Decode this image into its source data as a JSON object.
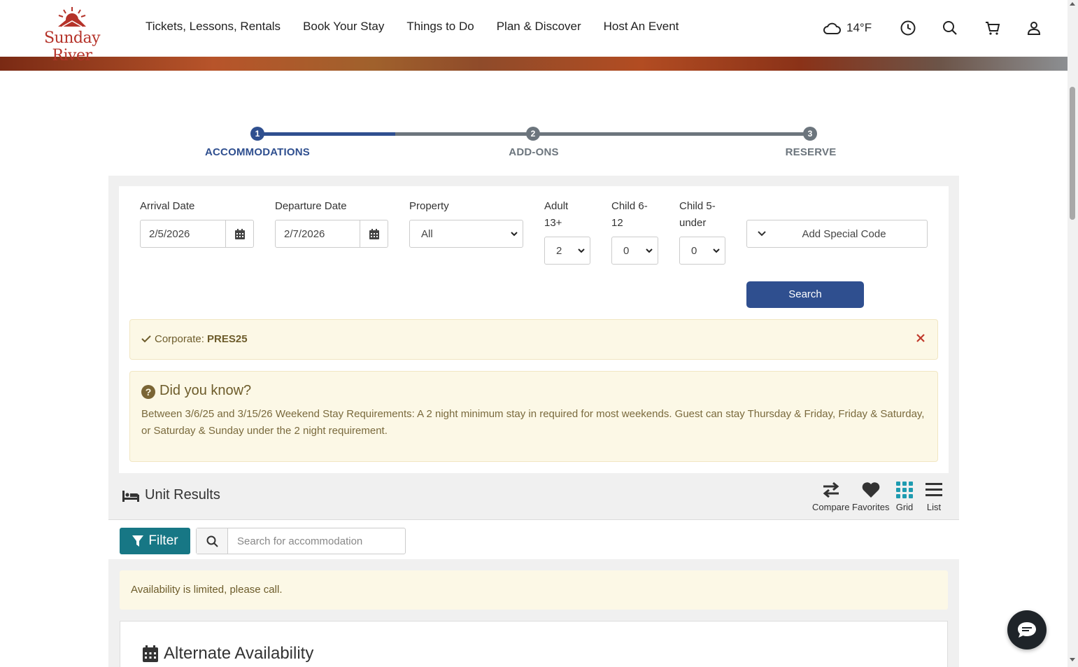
{
  "brand": {
    "name": "Sunday River",
    "color": "#b5332a"
  },
  "nav": {
    "items": [
      {
        "label": "Tickets, Lessons, Rentals"
      },
      {
        "label": "Book Your Stay"
      },
      {
        "label": "Things to Do"
      },
      {
        "label": "Plan & Discover"
      },
      {
        "label": "Host An Event"
      }
    ]
  },
  "tools": {
    "weather": "14°F"
  },
  "stepper": {
    "steps": [
      {
        "num": "1",
        "label": "ACCOMMODATIONS",
        "state": "active"
      },
      {
        "num": "2",
        "label": "ADD-ONS",
        "state": "pending"
      },
      {
        "num": "3",
        "label": "RESERVE",
        "state": "pending"
      }
    ]
  },
  "form": {
    "arrival": {
      "label": "Arrival Date",
      "value": "2/5/2026"
    },
    "departure": {
      "label": "Departure Date",
      "value": "2/7/2026"
    },
    "property": {
      "label": "Property",
      "value": "All"
    },
    "adult": {
      "label_line1": "Adult",
      "label_line2": "13+",
      "value": "2"
    },
    "child_6_12": {
      "label_line1": "Child 6-",
      "label_line2": "12",
      "value": "0"
    },
    "child_5_under": {
      "label_line1": "Child 5-",
      "label_line2": "under",
      "value": "0"
    },
    "special_code": "Add Special Code",
    "search_label": "Search"
  },
  "corporate_alert": {
    "prefix": "Corporate: ",
    "code": "PRES25"
  },
  "did_you_know": {
    "title": "Did you know?",
    "body": "Between 3/6/25 and 3/15/26 Weekend Stay Requirements: A 2 night minimum stay in required for most weekends. Guest can stay Thursday & Friday, Friday & Saturday, or Saturday & Sunday under the 2 night requirement."
  },
  "results": {
    "title": "Unit Results",
    "views": [
      {
        "label": "Compare"
      },
      {
        "label": "Favorites"
      },
      {
        "label": "Grid"
      },
      {
        "label": "List"
      }
    ],
    "filter_label": "Filter",
    "search_placeholder": "Search for accommodation",
    "limited_notice": "Availability is limited, please call.",
    "alternate_title": "Alternate Availability"
  },
  "colors": {
    "primary": "#2f4f8f",
    "teal": "#177785",
    "alert_bg": "#fcf8e6",
    "close_red": "#c0392b"
  }
}
